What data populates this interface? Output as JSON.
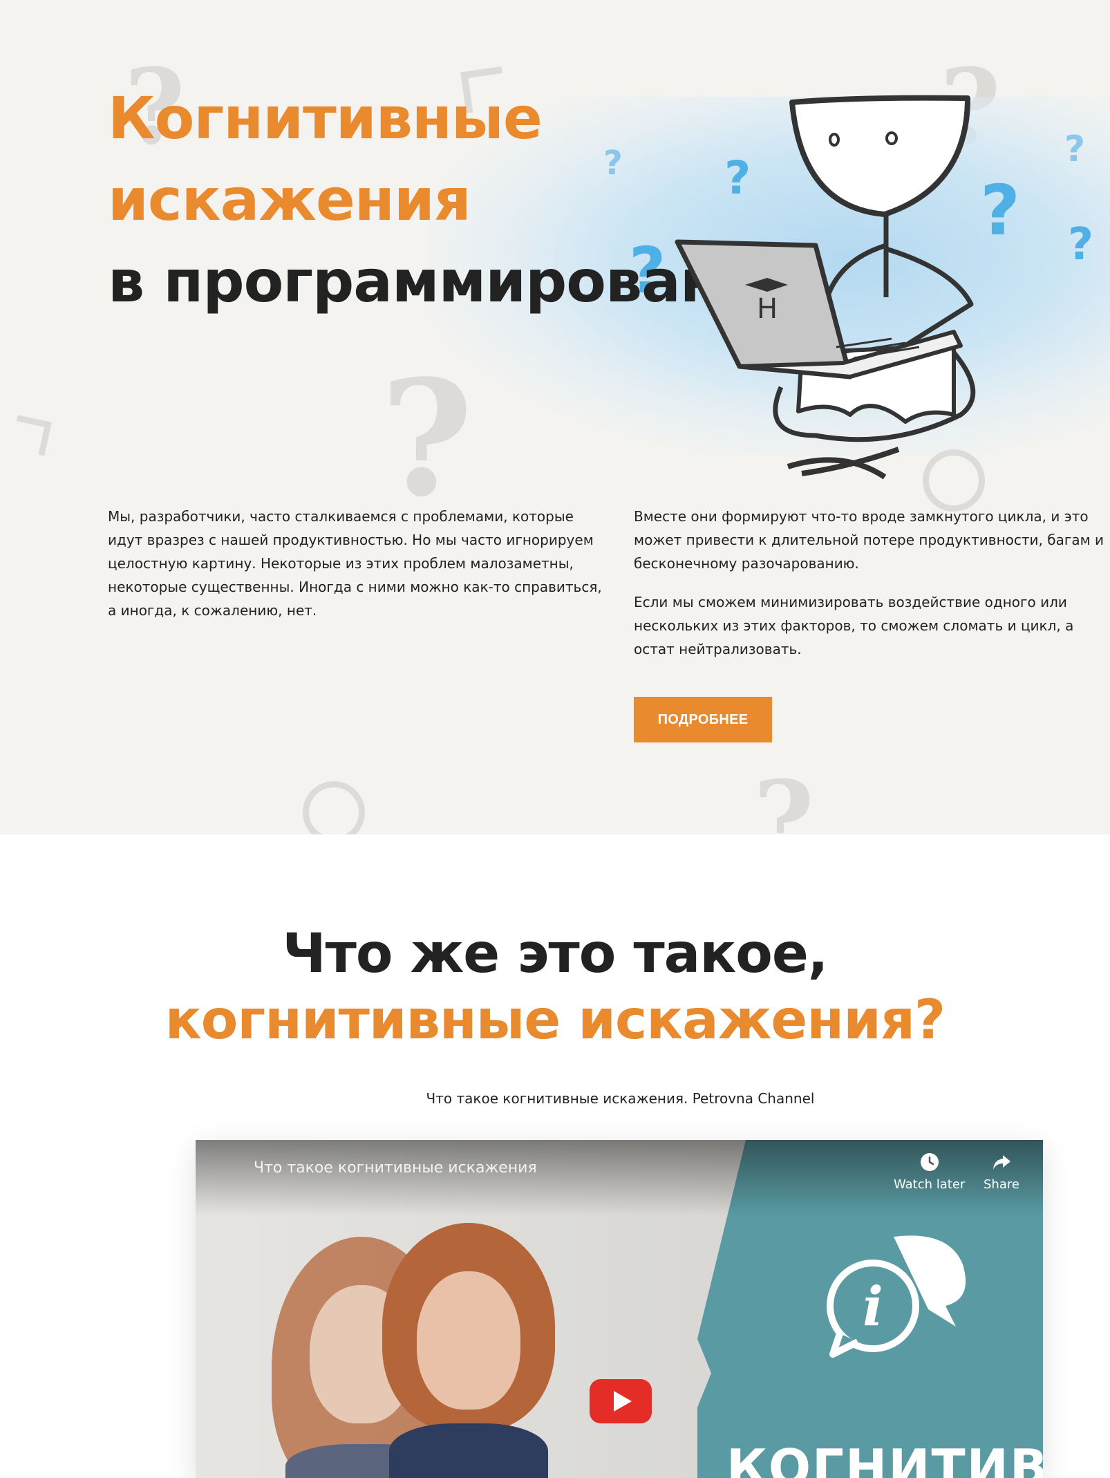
{
  "hero": {
    "title_line1": "Когнитивные",
    "title_line2": "искажения",
    "title_line3": "в программировании",
    "left_paragraph": "Мы, разработчики, часто сталкиваемся с проблемами, которые идут вразрез с нашей продуктивностью. Но мы часто игнорируем целостную картину. Некоторые из этих проблем малозаметны, некоторые существенны. Иногда с ними можно как-то справиться, а иногда, к сожалению, нет.",
    "right_paragraph1": "Вместе они формируют что-то вроде замкнутого цикла, и это может привести к длительной потере продуктивности, багам и бесконечному разочарованию.",
    "right_paragraph2": "Если мы сможем минимизировать воздействие одного или нескольких из этих факторов, то сможем сломать и цикл, а остат нейтрализовать.",
    "more_button": "ПОДРОБНЕЕ",
    "laptop_logo": "H"
  },
  "section2": {
    "title_line1": "Что же это такое,",
    "title_line2": "когнитивные искажения?",
    "video_caption": "Что такое когнитивные искажения. Petrovna Channel"
  },
  "video": {
    "title": "Что такое когнитивные искажения",
    "watch_later_label": "Watch later",
    "share_label": "Share",
    "overlay_text": "КОГНИТИВНЫЕ",
    "info_glyph": "i"
  },
  "colors": {
    "accent": "#ea8a2f",
    "hero_bg": "#f4f3f0",
    "teal": "#5a9aa3",
    "youtube_red": "#e52d27",
    "question_blue": "#4fb0e6"
  },
  "icons": [
    "question-mark-icon",
    "clock-icon",
    "share-arrow-icon",
    "play-icon",
    "chat-info-icon"
  ]
}
